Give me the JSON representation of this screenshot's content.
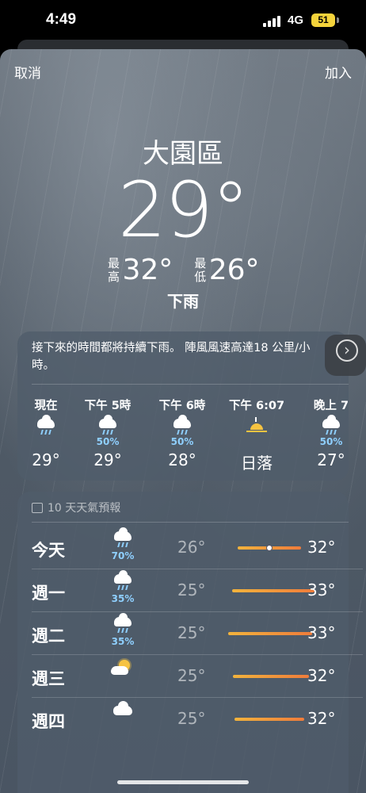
{
  "status_bar": {
    "time": "4:49",
    "network": "4G",
    "battery": "51"
  },
  "nav": {
    "cancel": "取消",
    "add": "加入"
  },
  "current": {
    "location": "大園區",
    "temperature": "29°",
    "high_label": "最高",
    "high": "32°",
    "low_label": "最低",
    "low": "26°",
    "condition": "下雨"
  },
  "hourly": {
    "summary": "接下來的時間都將持續下雨。 陣風風速高達18 公里/小時。",
    "items": [
      {
        "time": "現在",
        "icon": "cloud-rain-icon",
        "pop": "",
        "temp": "29°"
      },
      {
        "time": "下午 5時",
        "icon": "cloud-rain-icon",
        "pop": "50%",
        "temp": "29°"
      },
      {
        "time": "下午 6時",
        "icon": "cloud-rain-icon",
        "pop": "50%",
        "temp": "28°"
      },
      {
        "time": "下午 6:07",
        "icon": "sunset-icon",
        "pop": "",
        "temp": "日落"
      },
      {
        "time": "晚上 7",
        "icon": "cloud-rain-icon",
        "pop": "50%",
        "temp": "27°"
      }
    ]
  },
  "daily": {
    "header": "10 天天氣預報",
    "days": [
      {
        "day": "今天",
        "icon": "cloud-rain-icon",
        "pop": "70%",
        "low": "26°",
        "high": "32°",
        "current_dot": true
      },
      {
        "day": "週一",
        "icon": "cloud-rain-icon",
        "pop": "35%",
        "low": "25°",
        "high": "33°",
        "current_dot": false
      },
      {
        "day": "週二",
        "icon": "cloud-rain-icon",
        "pop": "35%",
        "low": "25°",
        "high": "33°",
        "current_dot": false
      },
      {
        "day": "週三",
        "icon": "partly-sunny-icon",
        "pop": "",
        "low": "25°",
        "high": "32°",
        "current_dot": false
      },
      {
        "day": "週四",
        "icon": "cloud-icon",
        "pop": "",
        "low": "25°",
        "high": "32°",
        "current_dot": false
      }
    ]
  },
  "colors": {
    "precip": "#8fd0ff",
    "bar_start": "#f2b33c",
    "bar_end": "#ef7c3b",
    "sun": "#f6c341",
    "battery": "#f4d33b"
  }
}
